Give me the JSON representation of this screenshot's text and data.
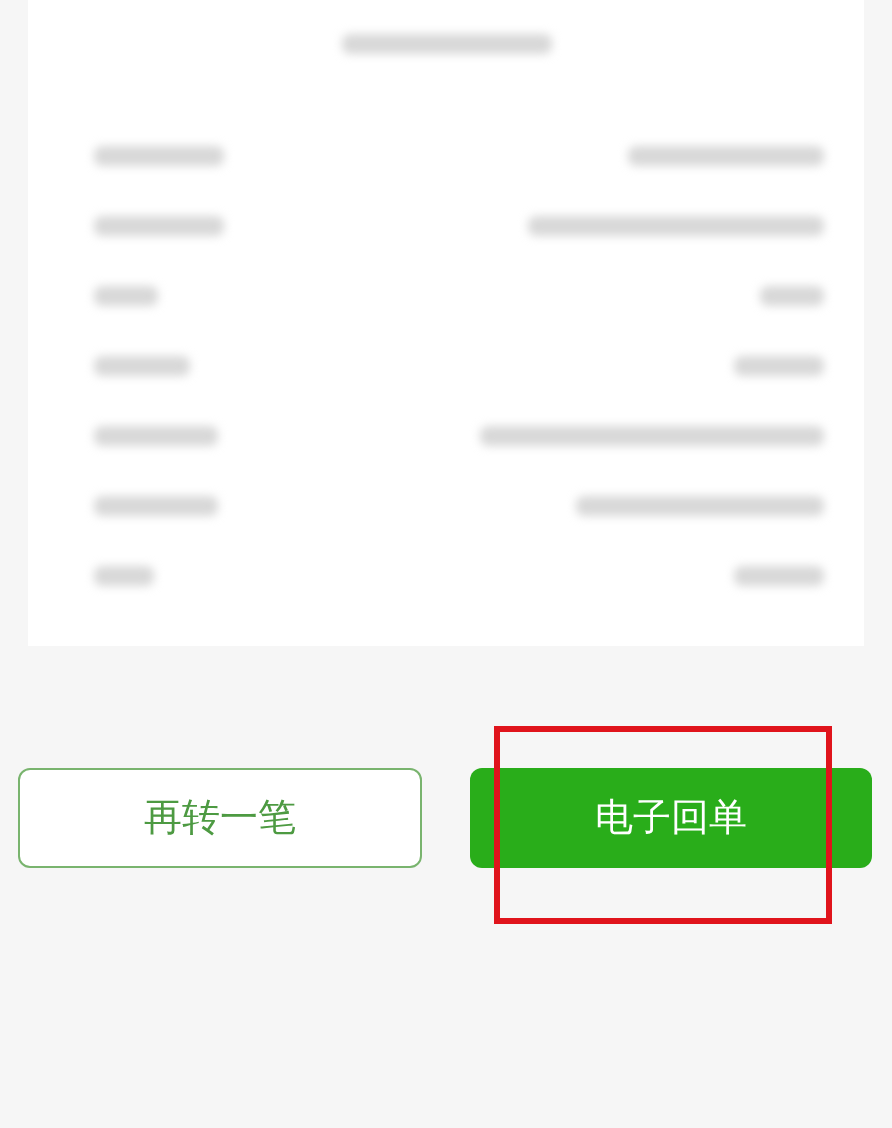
{
  "receipt": {
    "subtitle": {
      "kind": "redacted"
    },
    "rows": [
      {
        "kind": "redacted"
      },
      {
        "kind": "redacted"
      },
      {
        "kind": "redacted"
      },
      {
        "kind": "redacted"
      },
      {
        "kind": "redacted"
      },
      {
        "kind": "redacted"
      },
      {
        "kind": "redacted"
      }
    ]
  },
  "buttons": [
    {
      "label": "再转一笔",
      "kind": "outline"
    },
    {
      "label": "电子回单",
      "kind": "primary"
    }
  ],
  "highlight_box": true
}
